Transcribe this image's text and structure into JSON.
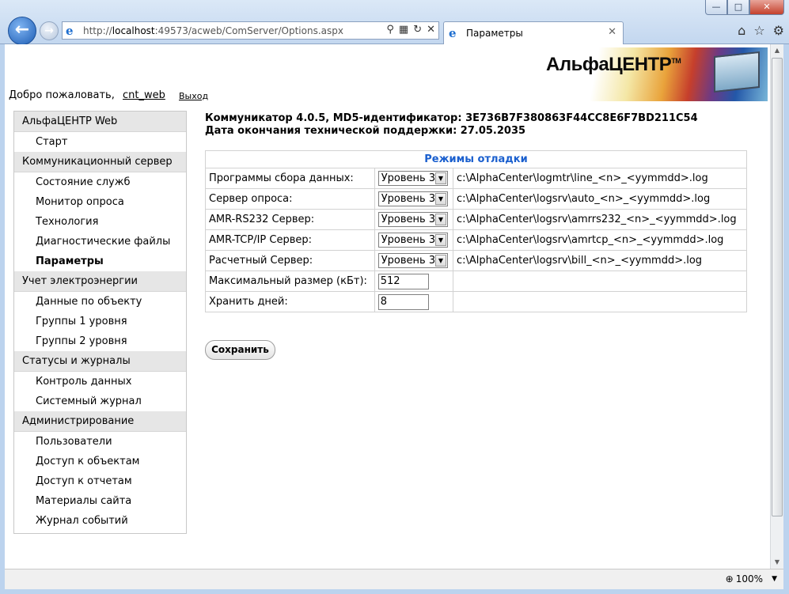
{
  "browser": {
    "url_prefix": "http://",
    "url_host": "localhost",
    "url_rest": ":49573/acweb/ComServer/Options.aspx",
    "tab_title": "Параметры",
    "zoom": "100%"
  },
  "logo": {
    "text": "АльфаЦЕНТР",
    "tm": "TM"
  },
  "header": {
    "welcome": "Добро пожаловать,",
    "user": "cnt_web",
    "logout": "Выход"
  },
  "sidebar": {
    "sections": [
      {
        "label": "АльфаЦЕНТР Web",
        "items": [
          "Старт"
        ]
      },
      {
        "label": "Коммуникационный сервер",
        "items": [
          "Состояние служб",
          "Монитор опроса",
          "Технология",
          "Диагностические файлы",
          "Параметры"
        ]
      },
      {
        "label": "Учет электроэнергии",
        "items": [
          "Данные по объекту",
          "Группы 1 уровня",
          "Группы 2 уровня"
        ]
      },
      {
        "label": "Статусы и журналы",
        "items": [
          "Контроль данных",
          "Системный журнал"
        ]
      },
      {
        "label": "Администрирование",
        "items": [
          "Пользователи",
          "Доступ к объектам",
          "Доступ к отчетам",
          "Материалы сайта",
          "Журнал событий"
        ]
      }
    ],
    "active_item": "Параметры"
  },
  "info": {
    "line1": "Коммуникатор 4.0.5, MD5-идентификатор: 3E736B7F380863F44CC8E6F7BD211C54",
    "line2": "Дата окончания технической поддержки: 27.05.2035"
  },
  "debug": {
    "caption": "Режимы отладки",
    "rows": [
      {
        "label": "Программы сбора данных:",
        "level": "Уровень 3",
        "path": "c:\\AlphaCenter\\logmtr\\line_<n>_<yymmdd>.log"
      },
      {
        "label": "Сервер опроса:",
        "level": "Уровень 3",
        "path": "c:\\AlphaCenter\\logsrv\\auto_<n>_<yymmdd>.log"
      },
      {
        "label": "AMR-RS232 Сервер:",
        "level": "Уровень 3",
        "path": "c:\\AlphaCenter\\logsrv\\amrrs232_<n>_<yymmdd>.log"
      },
      {
        "label": "AMR-TCP/IP Сервер:",
        "level": "Уровень 3",
        "path": "c:\\AlphaCenter\\logsrv\\amrtcp_<n>_<yymmdd>.log"
      },
      {
        "label": "Расчетный Сервер:",
        "level": "Уровень 3",
        "path": "c:\\AlphaCenter\\logsrv\\bill_<n>_<yymmdd>.log"
      }
    ],
    "max_size_label": "Максимальный размер (кБт):",
    "max_size_value": "512",
    "keep_days_label": "Хранить дней:",
    "keep_days_value": "8"
  },
  "save_label": "Сохранить"
}
